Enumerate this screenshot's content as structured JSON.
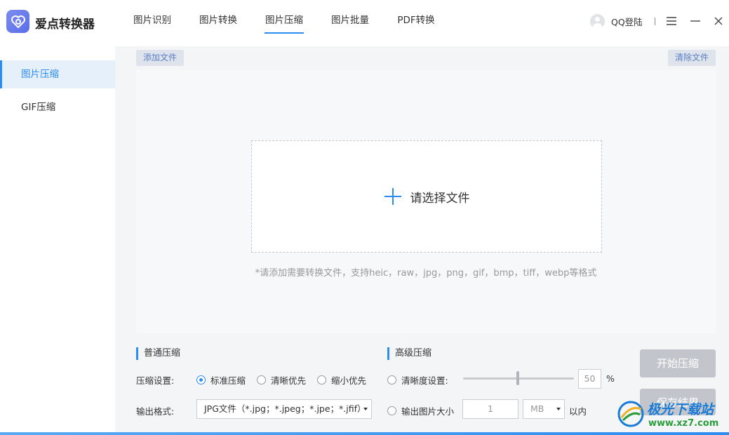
{
  "app": {
    "title": "爱点转换器",
    "accent_color": "#2d8cf0"
  },
  "nav": {
    "items": [
      {
        "label": "图片识别",
        "active": false
      },
      {
        "label": "图片转换",
        "active": false
      },
      {
        "label": "图片压缩",
        "active": true
      },
      {
        "label": "图片批量",
        "active": false
      },
      {
        "label": "PDF转换",
        "active": false
      }
    ]
  },
  "header": {
    "login_label": "QQ登陆",
    "menu_icon": "hamburger-icon",
    "minimize_icon": "minimize-icon",
    "close_icon": "close-icon"
  },
  "sidebar": {
    "items": [
      {
        "label": "图片压缩",
        "active": true
      },
      {
        "label": "GIF压缩",
        "active": false
      }
    ]
  },
  "toolbar": {
    "add_file_label": "添加文件",
    "clear_files_label": "清除文件"
  },
  "drop_area": {
    "label": "请选择文件",
    "hint": "*请添加需要转换文件，支持heic，raw，jpg，png，gif，bmp，tiff，webp等格式"
  },
  "normal_compress": {
    "title": "普通压缩",
    "settings_label": "压缩设置:",
    "options": [
      {
        "label": "标准压缩",
        "checked": true
      },
      {
        "label": "清晰优先",
        "checked": false
      },
      {
        "label": "缩小优先",
        "checked": false
      }
    ],
    "format_label": "输出格式:",
    "format_value": "JPG文件（*.jpg；*.jpeg；*.jpe；*.jfif）"
  },
  "advanced_compress": {
    "title": "高级压缩",
    "clarity_label": "清晰度设置:",
    "clarity_value": "50",
    "clarity_unit": "%",
    "size_label": "输出图片大小",
    "size_value": "1",
    "size_unit": "MB",
    "size_suffix": "以内"
  },
  "actions": {
    "start_label": "开始压缩",
    "save_label": "保存结果"
  },
  "watermark": {
    "line1": "极光下载站",
    "line2": "www.xz7.com"
  }
}
